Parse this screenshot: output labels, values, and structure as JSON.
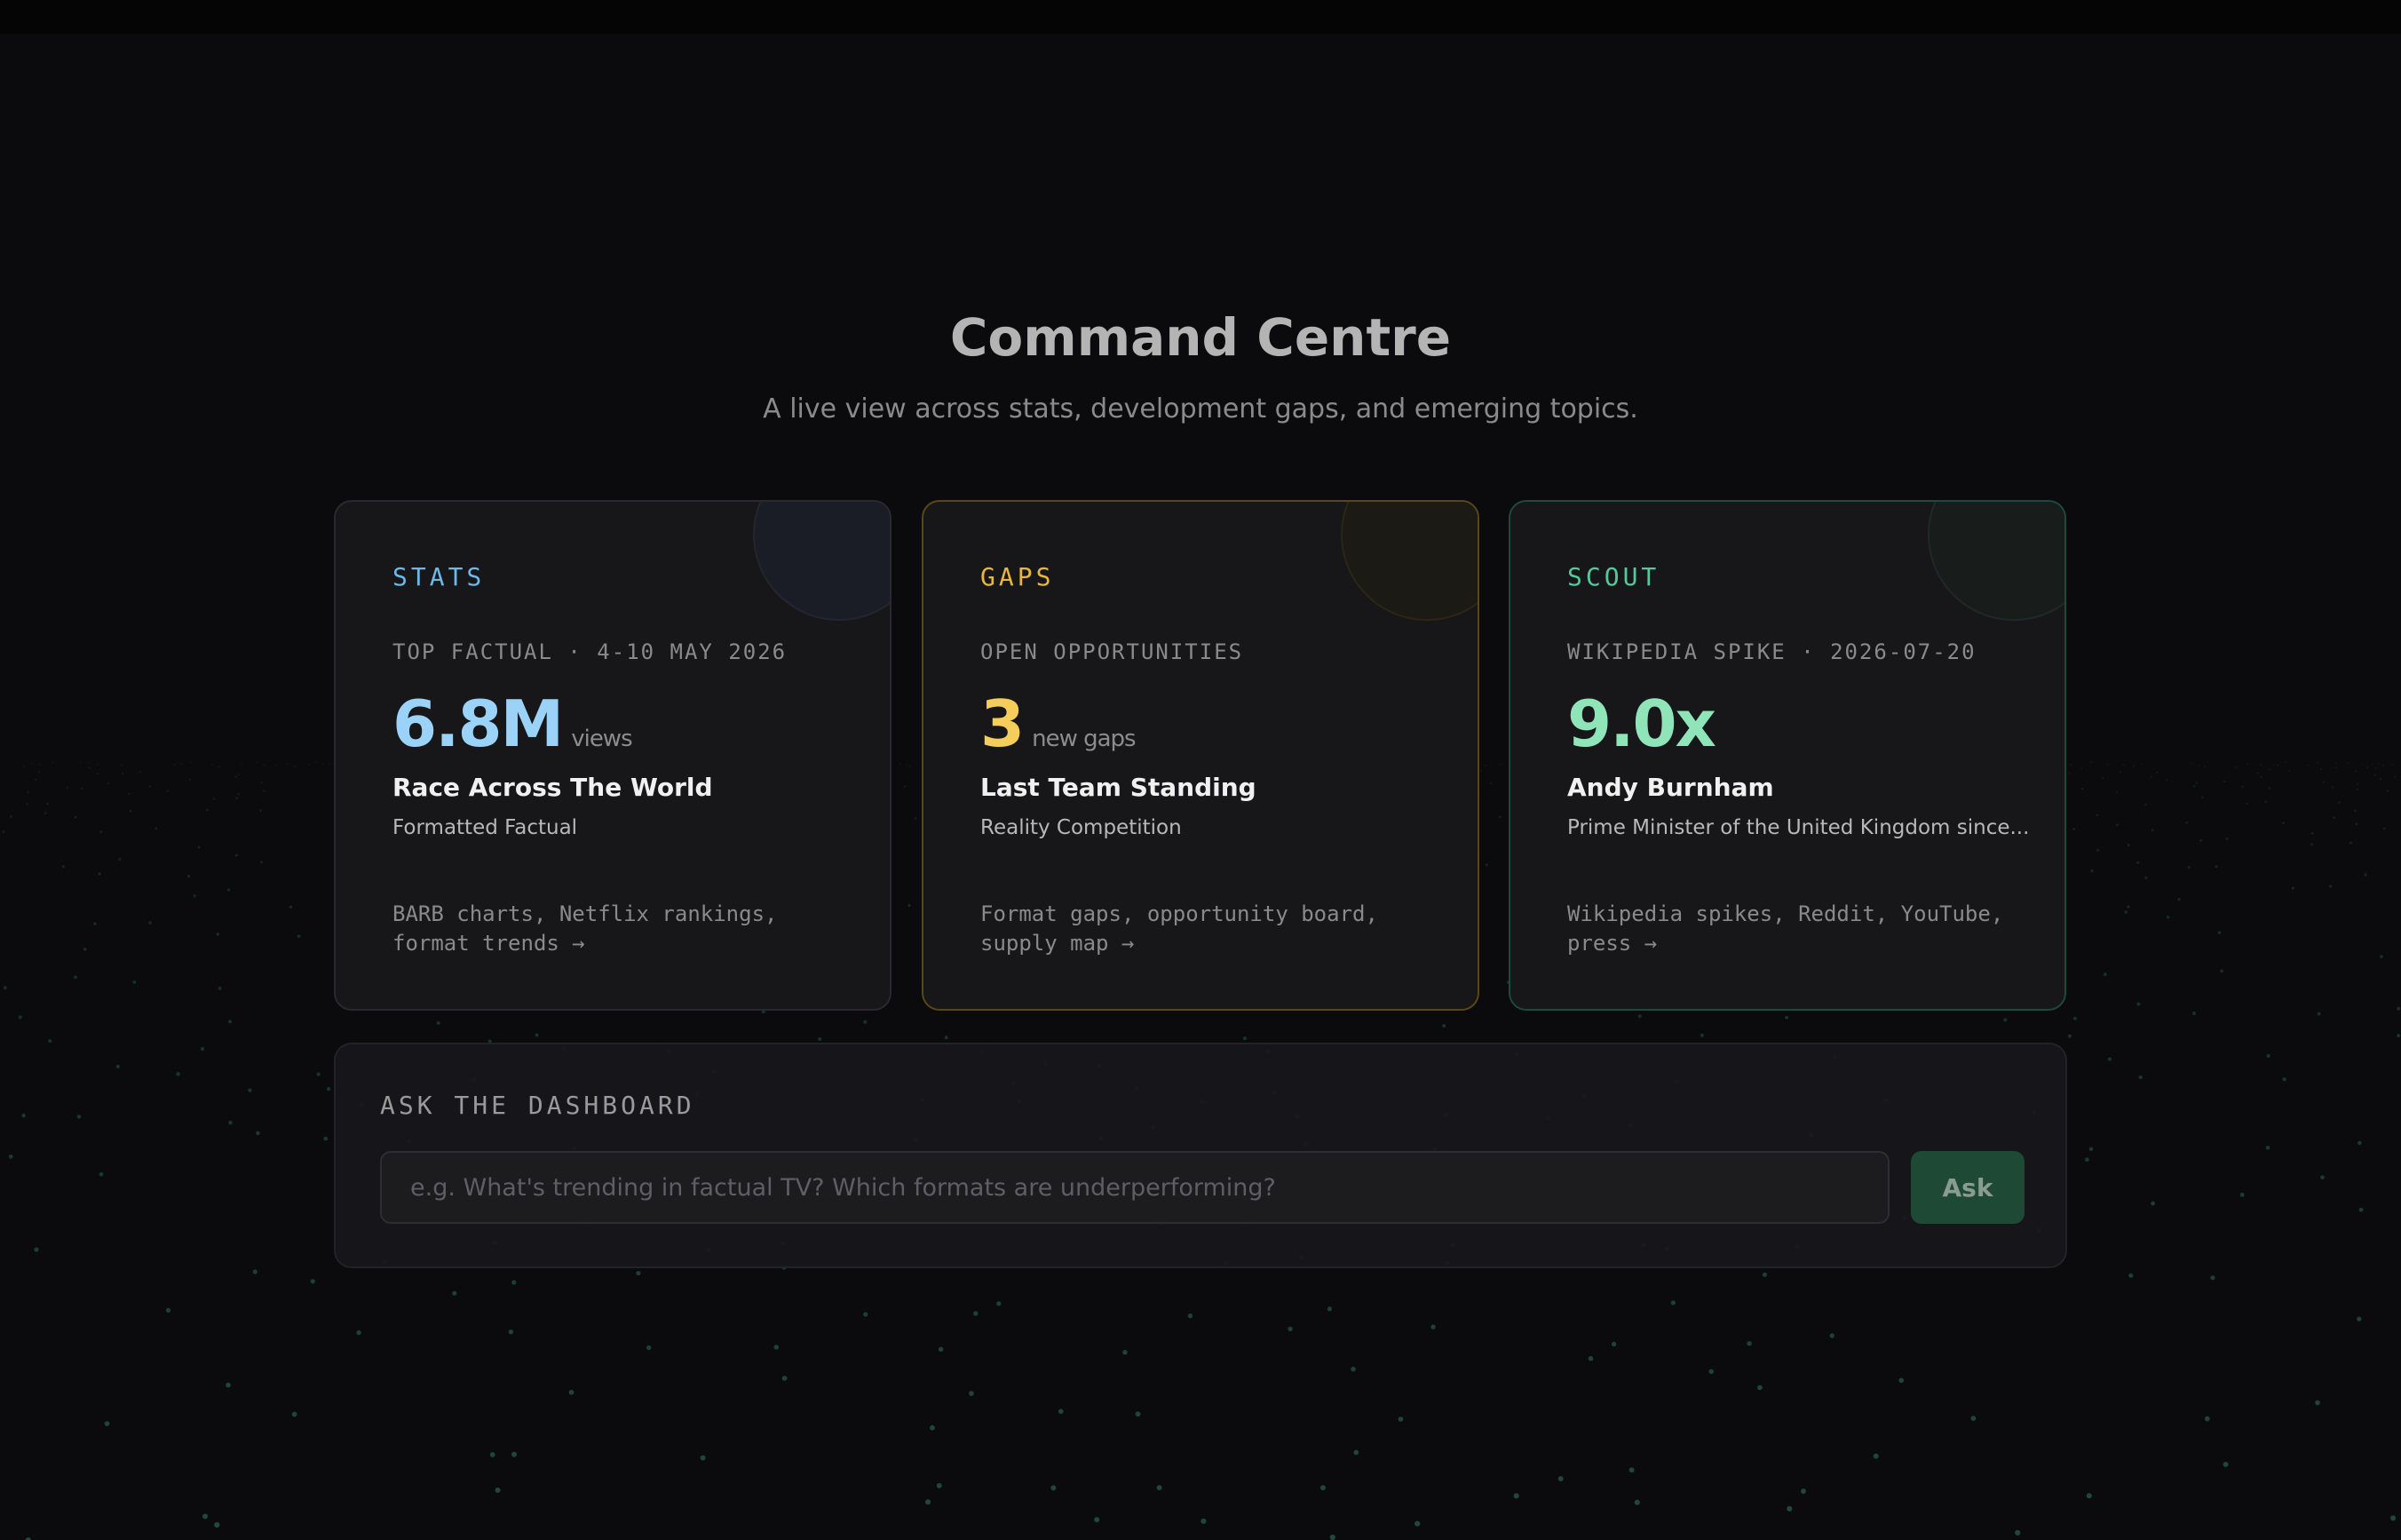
{
  "header": {
    "title": "Command Centre",
    "subtitle": "A live view across stats, development gaps, and emerging topics."
  },
  "cards": [
    {
      "id": "stats",
      "label": "STATS",
      "meta": "TOP FACTUAL · 4-10 MAY 2026",
      "metric": "6.8M",
      "unit": "views",
      "title": "Race Across The World",
      "subtitle": "Formatted Factual",
      "footer": "BARB charts, Netflix rankings, format trends →",
      "accent": "#9ad3f7"
    },
    {
      "id": "gaps",
      "label": "GAPS",
      "meta": "OPEN OPPORTUNITIES",
      "metric": "3",
      "unit": "new gaps",
      "title": "Last Team Standing",
      "subtitle": "Reality Competition",
      "footer": "Format gaps, opportunity board, supply map →",
      "accent": "#f5cd5a"
    },
    {
      "id": "scout",
      "label": "SCOUT",
      "meta": "WIKIPEDIA SPIKE · 2026-07-20",
      "metric": "9.0x",
      "unit": "",
      "title": "Andy Burnham",
      "subtitle": "Prime Minister of the United Kingdom since...",
      "footer": "Wikipedia spikes, Reddit, YouTube, press →",
      "accent": "#8fe5b8"
    }
  ],
  "ask": {
    "label": "ASK THE DASHBOARD",
    "placeholder": "e.g. What's trending in factual TV? Which formats are underperforming?",
    "value": "",
    "button_label": "Ask",
    "button_color": "#1e4a35"
  }
}
